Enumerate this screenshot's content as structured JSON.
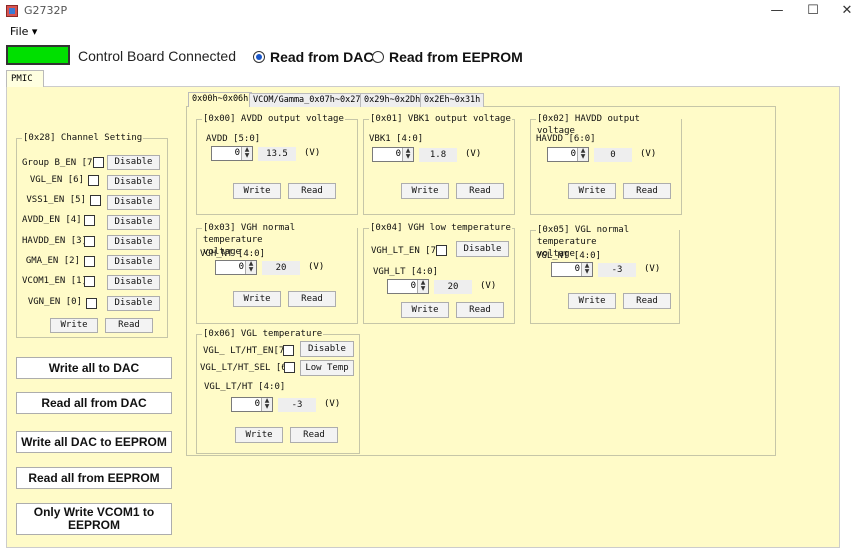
{
  "window": {
    "title": "G2732P",
    "min": "—",
    "max": "☐",
    "close": "✕"
  },
  "menu": {
    "file": "File ▾"
  },
  "status": {
    "text": "Control Board Connected",
    "led_color": "#00e000"
  },
  "source": {
    "dac": "Read from DAC",
    "eeprom": "Read from EEPROM",
    "selected": "dac"
  },
  "main_tab": "PMIC",
  "subtabs": [
    "0x00h~0x06h",
    "VCOM/Gamma_0x07h~0x27h",
    "0x29h~0x2Dh",
    "0x2Eh~0x31h"
  ],
  "channel": {
    "title": "[0x28] Channel Setting",
    "rows": [
      {
        "label": "Group B_EN [7]",
        "btn": "Disable"
      },
      {
        "label": "VGL_EN [6]",
        "btn": "Disable"
      },
      {
        "label": "VSS1_EN [5]",
        "btn": "Disable"
      },
      {
        "label": "AVDD_EN [4]",
        "btn": "Disable"
      },
      {
        "label": "HAVDD_EN [3]",
        "btn": "Disable"
      },
      {
        "label": "GMA_EN [2]",
        "btn": "Disable"
      },
      {
        "label": "VCOM1_EN [1]",
        "btn": "Disable"
      },
      {
        "label": "VGN_EN [0]",
        "btn": "Disable"
      }
    ],
    "write": "Write",
    "read": "Read"
  },
  "actions": {
    "write_all_dac": "Write all to DAC",
    "read_all_dac": "Read all from DAC",
    "write_dac_eeprom": "Write all DAC to EEPROM",
    "read_all_eeprom": "Read all from EEPROM",
    "only_vcom1": "Only Write VCOM1 to EEPROM"
  },
  "reg": {
    "r00": {
      "title": "[0x00] AVDD output voltage",
      "field": "AVDD [5:0]",
      "spin": "0",
      "value": "13.5",
      "unit": "(V)",
      "write": "Write",
      "read": "Read"
    },
    "r01": {
      "title": "[0x01] VBK1 output voltage",
      "field": "VBK1 [4:0]",
      "spin": "0",
      "value": "1.8",
      "unit": "(V)",
      "write": "Write",
      "read": "Read"
    },
    "r02": {
      "title": "[0x02] HAVDD output voltage",
      "field": "HAVDD [6:0]",
      "spin": "0",
      "value": "0",
      "unit": "(V)",
      "write": "Write",
      "read": "Read"
    },
    "r03": {
      "title1": "[0x03] VGH normal temperature",
      "title2": "voltage",
      "field": "VGH_NT [4:0]",
      "spin": "0",
      "value": "20",
      "unit": "(V)",
      "write": "Write",
      "read": "Read"
    },
    "r04": {
      "title": "[0x04] VGH low temperature",
      "en_label": "VGH_LT_EN [7]",
      "en_btn": "Disable",
      "field": "VGH_LT [4:0]",
      "spin": "0",
      "value": "20",
      "unit": "(V)",
      "write": "Write",
      "read": "Read"
    },
    "r05": {
      "title1": "[0x05] VGL normal temperature",
      "title2": "voltage",
      "field": "VGL_NT [4:0]",
      "spin": "0",
      "value": "-3",
      "unit": "(V)",
      "write": "Write",
      "read": "Read"
    },
    "r06": {
      "title": "[0x06] VGL temperature",
      "en_label": "VGL_ LT/HT_EN[7]",
      "en_btn": "Disable",
      "sel_label": "VGL_LT/HT_SEL [6]",
      "sel_btn": "Low Temp",
      "field": "VGL_LT/HT [4:0]",
      "spin": "0",
      "value": "-3",
      "unit": "(V)",
      "write": "Write",
      "read": "Read"
    }
  }
}
